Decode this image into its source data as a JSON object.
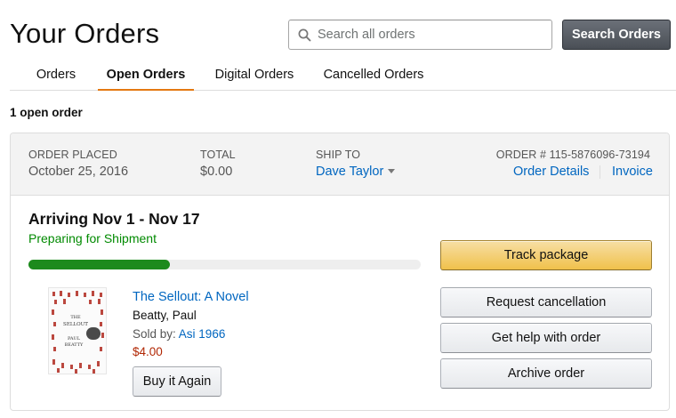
{
  "header": {
    "title": "Your Orders",
    "search_placeholder": "Search all orders",
    "search_button": "Search Orders"
  },
  "tabs": [
    {
      "label": "Orders",
      "active": false
    },
    {
      "label": "Open Orders",
      "active": true
    },
    {
      "label": "Digital Orders",
      "active": false
    },
    {
      "label": "Cancelled Orders",
      "active": false
    }
  ],
  "open_count_text": "1 open order",
  "order": {
    "placed_label": "ORDER PLACED",
    "placed_value": "October 25, 2016",
    "total_label": "TOTAL",
    "total_value": "$0.00",
    "ship_to_label": "SHIP TO",
    "ship_to_value": "Dave Taylor",
    "order_number_label": "ORDER # 115-5876096-73194",
    "order_details_link": "Order Details",
    "invoice_link": "Invoice",
    "arriving": "Arriving Nov 1 - Nov 17",
    "status": "Preparing for Shipment",
    "progress_fraction": 0.36,
    "colors": {
      "progress": "#1c8a1c",
      "status": "#008a00",
      "price": "#b12704",
      "link": "#0066c0",
      "accent_tab": "#e47911"
    },
    "item": {
      "title": "The Sellout: A Novel",
      "author": "Beatty, Paul",
      "sold_by_label": "Sold by: ",
      "seller": "Asi 1966",
      "price": "$4.00",
      "buy_again_button": "Buy it Again",
      "cover": {
        "line1": "THE",
        "line2": "SELLOUT",
        "line3": "PAUL",
        "line4": "BEATTY"
      }
    },
    "actions": {
      "track": "Track package",
      "cancel": "Request cancellation",
      "help": "Get help with order",
      "archive": "Archive order"
    }
  }
}
